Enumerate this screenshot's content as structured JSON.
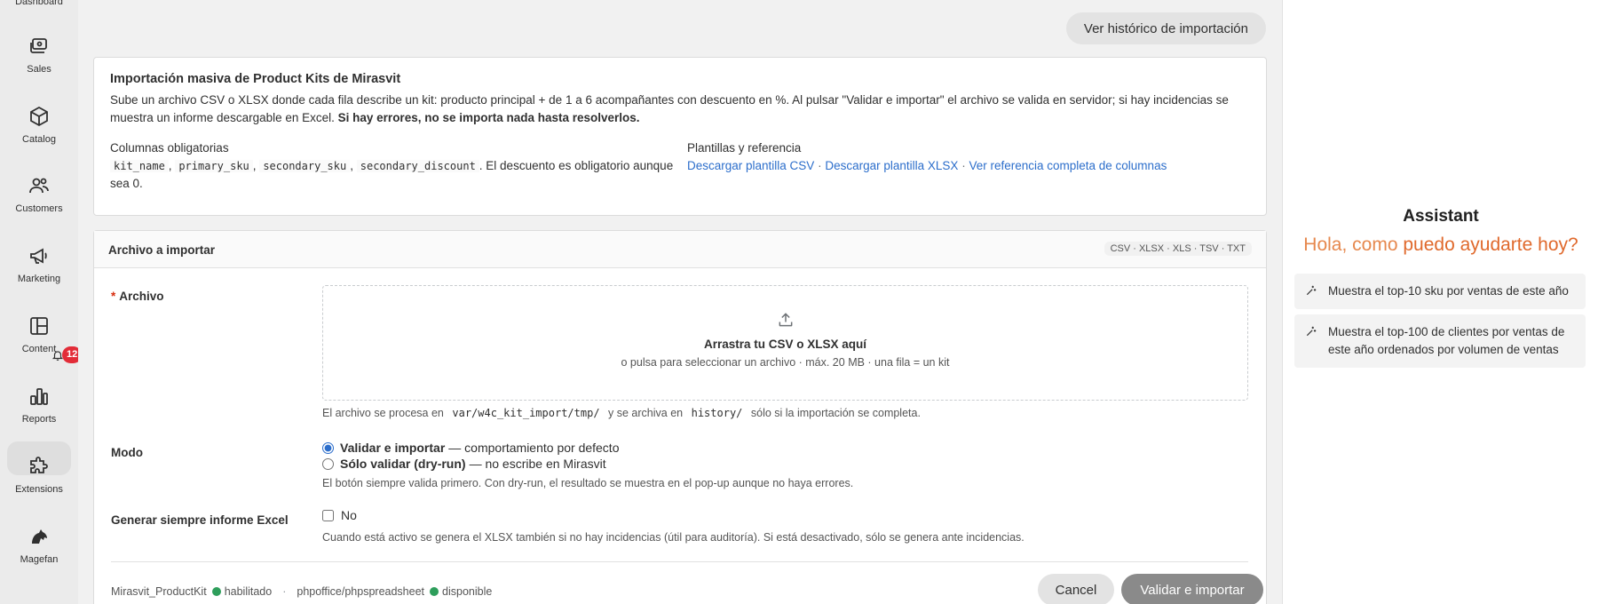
{
  "sidebar": {
    "top_label": "Dashboard",
    "items": [
      {
        "label": "Sales",
        "icon": "sales-icon"
      },
      {
        "label": "Catalog",
        "icon": "catalog-icon"
      },
      {
        "label": "Customers",
        "icon": "customers-icon"
      },
      {
        "label": "Marketing",
        "icon": "megaphone-icon"
      },
      {
        "label": "Content",
        "icon": "content-icon"
      },
      {
        "label": "Reports",
        "icon": "reports-icon"
      },
      {
        "label": "Extensions",
        "icon": "puzzle-icon"
      },
      {
        "label": "Magefan",
        "icon": "magefan-icon"
      }
    ],
    "notifications": {
      "count": "12"
    }
  },
  "header": {
    "history_button": "Ver histórico de importación"
  },
  "intro": {
    "title": "Importación masiva de Product Kits de Mirasvit",
    "description": "Sube un archivo CSV o XLSX donde cada fila describe un kit: producto principal + de 1 a 6 acompañantes con descuento en %. Al pulsar \"Validar e importar\" el archivo se valida en servidor; si hay incidencias se muestra un informe descargable en Excel.",
    "description_bold": "Si hay errores, no se importa nada hasta resolverlos.",
    "required_title": "Columnas obligatorias",
    "required_cols": [
      "kit_name",
      "primary_sku",
      "secondary_sku",
      "secondary_discount"
    ],
    "required_note": ". El descuento es obligatorio aunque sea 0.",
    "templates_title": "Plantillas y referencia",
    "links": [
      "Descargar plantilla CSV",
      "Descargar plantilla XLSX",
      "Ver referencia completa de columnas"
    ],
    "link_sep": "·"
  },
  "form": {
    "section_title": "Archivo a importar",
    "formats": "CSV · XLSX · XLS · TSV · TXT",
    "file_label": "Archivo",
    "required_mark": "*",
    "drop_title": "Arrastra tu CSV o XLSX aquí",
    "drop_sub": "o pulsa para seleccionar un archivo · máx. 20 MB · una fila = un kit",
    "path_note_1": "El archivo se procesa en",
    "path_tmp": "var/w4c_kit_import/tmp/",
    "path_note_2": "y se archiva en",
    "path_history": "history/",
    "path_note_3": "sólo si la importación se completa.",
    "mode_label": "Modo",
    "mode_opt1_bold": "Validar e importar",
    "mode_opt1_rest": "— comportamiento por defecto",
    "mode_opt2_bold": "Sólo validar (dry-run)",
    "mode_opt2_rest": "— no escribe en Mirasvit",
    "mode_note": "El botón siempre valida primero. Con dry-run, el resultado se muestra en el pop-up aunque no haya errores.",
    "excel_label": "Generar siempre informe Excel",
    "excel_value": "No",
    "excel_note": "Cuando está activo se genera el XLSX también si no hay incidencias (útil para auditoría). Si está desactivado, sólo se genera ante incidencias.",
    "status_mod1": "Mirasvit_ProductKit",
    "status_mod1_state": "habilitado",
    "status_sep": "·",
    "status_mod2": "phpoffice/phpspreadsheet",
    "status_mod2_state": "disponible",
    "cancel": "Cancel",
    "submit": "Validar e importar"
  },
  "assistant": {
    "title": "Assistant",
    "greeting_a": "Hola, como",
    "greeting_b": "puedo ayudarte hoy?",
    "suggestions": [
      "Muestra el top-10 sku por ventas de este año",
      "Muestra el top-100 de clientes por ventas de este año ordenados por volumen de ventas"
    ]
  },
  "colors": {
    "accent": "#2c6ecb",
    "ok": "#2e9e5b",
    "badge": "#e22c38",
    "greeting": "#e0692c"
  }
}
